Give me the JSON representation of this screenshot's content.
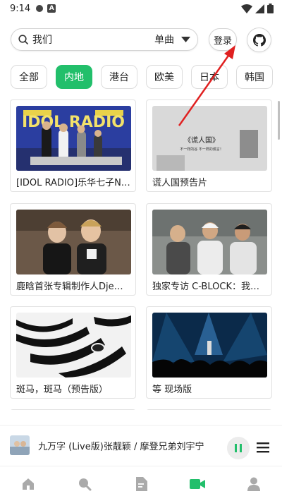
{
  "status_bar": {
    "time": "9:14",
    "notification_letter": "A"
  },
  "search": {
    "query": "我们",
    "scope": "单曲"
  },
  "header": {
    "login_label": "登录"
  },
  "region_tabs": [
    {
      "label": "全部",
      "active": false
    },
    {
      "label": "内地",
      "active": true
    },
    {
      "label": "港台",
      "active": false
    },
    {
      "label": "欧美",
      "active": false
    },
    {
      "label": "日本",
      "active": false
    },
    {
      "label": "韩国",
      "active": false
    }
  ],
  "videos": [
    {
      "title": "[IDOL RADIO]乐华七子NEXT...",
      "thumb_text": "IDOL RADIO"
    },
    {
      "title": "谎人国预告片",
      "thumb_text": "《谎人国》",
      "thumb_sub": "不一样的谷  不一样的谎言！"
    },
    {
      "title": "鹿晗首张专辑制作人Djemba..."
    },
    {
      "title": "独家专访 C-BLOCK：我们唱..."
    },
    {
      "title": "斑马，斑马（预告版）"
    },
    {
      "title": "等 现场版"
    }
  ],
  "player": {
    "song": "九万字 (Live版)",
    "artist": "张靓颖 / 摩登兄弟刘宇宁"
  },
  "colors": {
    "accent": "#22bf6b",
    "annotation_arrow": "#e02020"
  },
  "icons": {
    "search": "search-icon",
    "dropdown": "caret-down-icon",
    "github": "github-icon",
    "nav": [
      "home-icon",
      "discover-icon",
      "document-icon",
      "video-icon",
      "profile-icon"
    ]
  }
}
